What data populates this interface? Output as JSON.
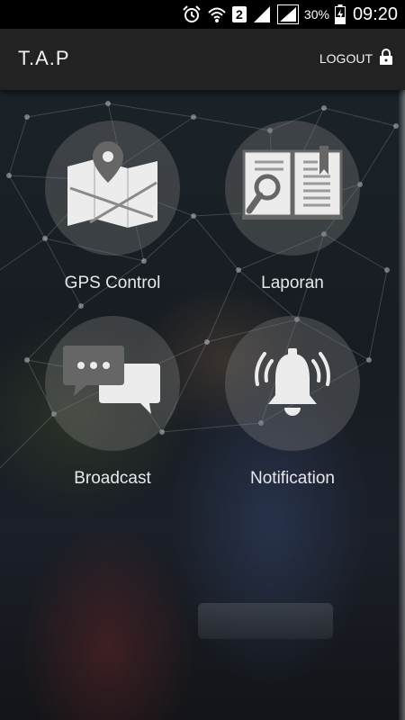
{
  "status_bar": {
    "sim_slot": "2",
    "battery": "30%",
    "time": "09:20",
    "icons": [
      "alarm-icon",
      "wifi-icon",
      "signal-icon",
      "battery-icon"
    ]
  },
  "app_bar": {
    "title": "T.A.P",
    "logout_label": "LOGOUT",
    "logout_icon": "lock-icon"
  },
  "menu": {
    "items": [
      {
        "label": "GPS Control",
        "icon": "map-pin-icon"
      },
      {
        "label": "Laporan",
        "icon": "book-search-icon"
      },
      {
        "label": "Broadcast",
        "icon": "chat-bubbles-icon"
      },
      {
        "label": "Notification",
        "icon": "bell-icon"
      }
    ]
  },
  "colors": {
    "status_bar_bg": "#000000",
    "app_bar_bg": "#222222",
    "tile_bg": "#787878",
    "icon_fill": "#eeeeee",
    "icon_dark": "#666666"
  }
}
